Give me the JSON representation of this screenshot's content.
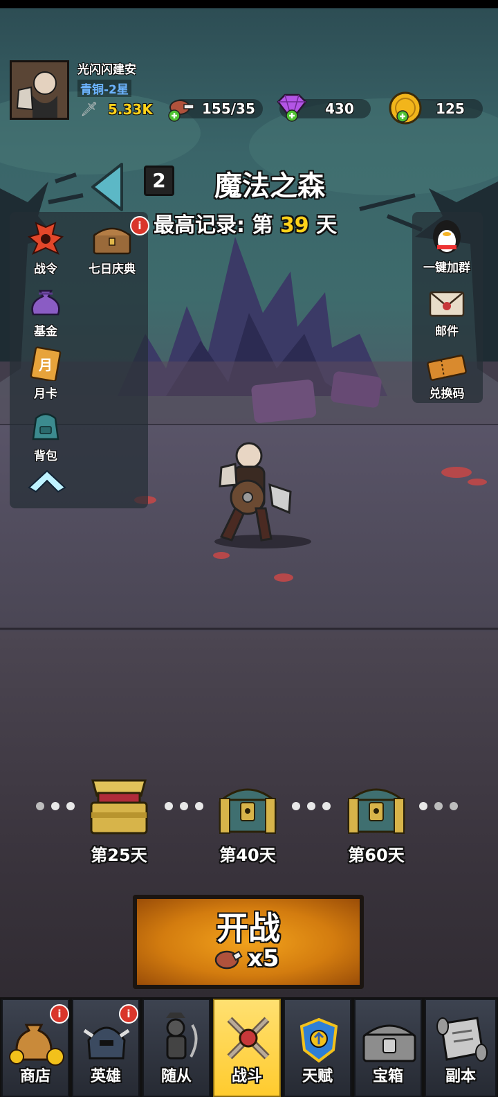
{
  "player": {
    "name": "光闪闪建安",
    "rank": "青铜-2星",
    "power": "5.33K",
    "stamina": "155/35",
    "gems": "430",
    "gold": "125"
  },
  "stage": {
    "number": "2",
    "name": "魔法之森",
    "record_prefix": "最高记录: 第",
    "record_day": "39",
    "record_suffix": "天"
  },
  "left_menu": [
    {
      "label": "战令",
      "icon": "battle-pass-icon",
      "badge": false
    },
    {
      "label": "七日庆典",
      "icon": "treasure-chest-icon",
      "badge": true
    },
    {
      "label": "基金",
      "icon": "money-bag-icon",
      "badge": false
    },
    {
      "label": "月卡",
      "icon": "month-card-icon",
      "badge": false
    },
    {
      "label": "背包",
      "icon": "backpack-icon",
      "badge": false
    }
  ],
  "right_menu": [
    {
      "label": "一键加群",
      "icon": "penguin-icon"
    },
    {
      "label": "邮件",
      "icon": "mail-icon"
    },
    {
      "label": "兑换码",
      "icon": "ticket-icon"
    }
  ],
  "rewards": [
    {
      "label": "第25天",
      "state": "opened"
    },
    {
      "label": "第40天",
      "state": "locked"
    },
    {
      "label": "第60天",
      "state": "locked"
    }
  ],
  "start_button": {
    "label": "开战",
    "cost": "x5"
  },
  "badge_text": "i",
  "tabs": [
    {
      "label": "商店",
      "icon": "coin-sack-icon",
      "badge": true,
      "active": false
    },
    {
      "label": "英雄",
      "icon": "helmet-icon",
      "badge": true,
      "active": false
    },
    {
      "label": "随从",
      "icon": "minion-icon",
      "badge": false,
      "active": false
    },
    {
      "label": "战斗",
      "icon": "crossed-swords-icon",
      "badge": false,
      "active": true
    },
    {
      "label": "天赋",
      "icon": "talent-shield-icon",
      "badge": false,
      "active": false
    },
    {
      "label": "宝箱",
      "icon": "chest-icon",
      "badge": false,
      "active": false
    },
    {
      "label": "副本",
      "icon": "scroll-map-icon",
      "badge": false,
      "active": false
    }
  ],
  "colors": {
    "accent_yellow": "#ffd21a",
    "rank_blue": "#6db4ff",
    "active_tab": "#ffcb2e",
    "start_button": "#e38b12"
  }
}
